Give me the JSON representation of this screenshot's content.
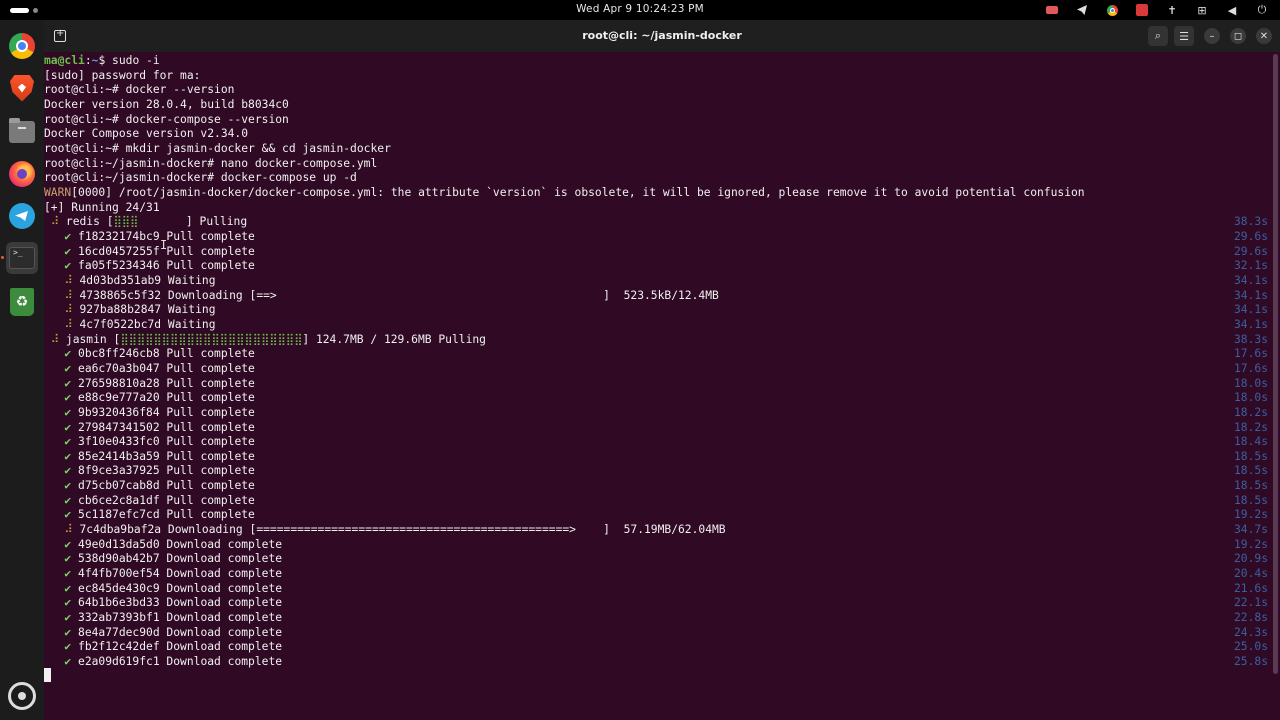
{
  "topbar": {
    "clock": "Wed Apr 9  10:24:23 PM",
    "power_icon": "⏻"
  },
  "window": {
    "title": "root@cli: ~/jasmin-docker"
  },
  "terminal": {
    "lines": [
      {
        "parts": [
          [
            "prompt-user",
            "ma@cli"
          ],
          [
            "",
            "",
            ""
          ],
          [
            "",
            ":"
          ],
          [
            "prompt-path",
            "~"
          ],
          [
            "",
            "$ sudo -i"
          ]
        ]
      },
      {
        "parts": [
          [
            "",
            "[sudo] password for ma:"
          ]
        ]
      },
      {
        "parts": [
          [
            "",
            "root@cli:~# docker --version"
          ]
        ]
      },
      {
        "parts": [
          [
            "",
            "Docker version 28.0.4, build b8034c0"
          ]
        ]
      },
      {
        "parts": [
          [
            "",
            "root@cli:~# docker-compose --version"
          ]
        ]
      },
      {
        "parts": [
          [
            "",
            "Docker Compose version v2.34.0"
          ]
        ]
      },
      {
        "parts": [
          [
            "",
            "root@cli:~# mkdir jasmin-docker && cd jasmin-docker"
          ]
        ]
      },
      {
        "parts": [
          [
            "",
            "root@cli:~/jasmin-docker# nano docker-compose.yml"
          ]
        ]
      },
      {
        "parts": [
          [
            "",
            "root@cli:~/jasmin-docker# docker-compose up -d"
          ]
        ]
      },
      {
        "parts": [
          [
            "warn",
            "WARN"
          ],
          [
            "",
            "[0000] /root/jasmin-docker/docker-compose.yml: the attribute `version` is obsolete, it will be ignored, please remove it to avoid potential confusion"
          ]
        ]
      },
      {
        "parts": [
          [
            "",
            "[+] Running 24/31"
          ]
        ]
      },
      {
        "parts": [
          [
            "spin",
            " ⠼ "
          ],
          [
            "",
            "redis ["
          ],
          [
            "bar",
            "⣿⣿⣿"
          ],
          [
            "",
            "       ] Pulling"
          ]
        ],
        "time": "38.3s"
      },
      {
        "parts": [
          [
            "check",
            "   ✔ "
          ],
          [
            "",
            "f18232174bc9 Pull complete"
          ]
        ],
        "time": "29.6s"
      },
      {
        "parts": [
          [
            "check",
            "   ✔ "
          ],
          [
            "",
            "16cd0457255f Pull complete"
          ]
        ],
        "time": "29.6s"
      },
      {
        "parts": [
          [
            "check",
            "   ✔ "
          ],
          [
            "",
            "fa05f5234346 Pull complete"
          ]
        ],
        "time": "32.1s"
      },
      {
        "parts": [
          [
            "spin",
            "   ⠼ "
          ],
          [
            "",
            "4d03bd351ab9 Waiting"
          ]
        ],
        "time": "34.1s"
      },
      {
        "parts": [
          [
            "spin",
            "   ⠼ "
          ],
          [
            "",
            "4738865c5f32 Downloading [==>                                                ]  523.5kB/12.4MB"
          ]
        ],
        "time": "34.1s"
      },
      {
        "parts": [
          [
            "spin",
            "   ⠼ "
          ],
          [
            "",
            "927ba88b2847 Waiting"
          ]
        ],
        "time": "34.1s"
      },
      {
        "parts": [
          [
            "spin",
            "   ⠼ "
          ],
          [
            "",
            "4c7f0522bc7d Waiting"
          ]
        ],
        "time": "34.1s"
      },
      {
        "parts": [
          [
            "spin",
            " ⠼ "
          ],
          [
            "",
            "jasmin ["
          ],
          [
            "bar",
            "⣿⣿⣿⣿⣿⣿⣿⣿⣿⣿⣿⣿⣿⣿⣿⣿⣿⣿⣿⣿⣿⣿"
          ],
          [
            "",
            "] 124.7MB / 129.6MB Pulling"
          ]
        ],
        "time": "38.3s"
      },
      {
        "parts": [
          [
            "check",
            "   ✔ "
          ],
          [
            "",
            "0bc8ff246cb8 Pull complete"
          ]
        ],
        "time": "17.6s"
      },
      {
        "parts": [
          [
            "check",
            "   ✔ "
          ],
          [
            "",
            "ea6c70a3b047 Pull complete"
          ]
        ],
        "time": "17.6s"
      },
      {
        "parts": [
          [
            "check",
            "   ✔ "
          ],
          [
            "",
            "276598810a28 Pull complete"
          ]
        ],
        "time": "18.0s"
      },
      {
        "parts": [
          [
            "check",
            "   ✔ "
          ],
          [
            "",
            "e88c9e777a20 Pull complete"
          ]
        ],
        "time": "18.0s"
      },
      {
        "parts": [
          [
            "check",
            "   ✔ "
          ],
          [
            "",
            "9b9320436f84 Pull complete"
          ]
        ],
        "time": "18.2s"
      },
      {
        "parts": [
          [
            "check",
            "   ✔ "
          ],
          [
            "",
            "279847341502 Pull complete"
          ]
        ],
        "time": "18.2s"
      },
      {
        "parts": [
          [
            "check",
            "   ✔ "
          ],
          [
            "",
            "3f10e0433fc0 Pull complete"
          ]
        ],
        "time": "18.4s"
      },
      {
        "parts": [
          [
            "check",
            "   ✔ "
          ],
          [
            "",
            "85e2414b3a59 Pull complete"
          ]
        ],
        "time": "18.5s"
      },
      {
        "parts": [
          [
            "check",
            "   ✔ "
          ],
          [
            "",
            "8f9ce3a37925 Pull complete"
          ]
        ],
        "time": "18.5s"
      },
      {
        "parts": [
          [
            "check",
            "   ✔ "
          ],
          [
            "",
            "d75cb07cab8d Pull complete"
          ]
        ],
        "time": "18.5s"
      },
      {
        "parts": [
          [
            "check",
            "   ✔ "
          ],
          [
            "",
            "cb6ce2c8a1df Pull complete"
          ]
        ],
        "time": "18.5s"
      },
      {
        "parts": [
          [
            "check",
            "   ✔ "
          ],
          [
            "",
            "5c1187efc7cd Pull complete"
          ]
        ],
        "time": "19.2s"
      },
      {
        "parts": [
          [
            "spin",
            "   ⠼ "
          ],
          [
            "",
            "7c4dba9baf2a Downloading [==============================================>    ]  57.19MB/62.04MB"
          ]
        ],
        "time": "34.7s"
      },
      {
        "parts": [
          [
            "check",
            "   ✔ "
          ],
          [
            "",
            "49e0d13da5d0 Download complete"
          ]
        ],
        "time": "19.2s"
      },
      {
        "parts": [
          [
            "check",
            "   ✔ "
          ],
          [
            "",
            "538d90ab42b7 Download complete"
          ]
        ],
        "time": "20.9s"
      },
      {
        "parts": [
          [
            "check",
            "   ✔ "
          ],
          [
            "",
            "4f4fb700ef54 Download complete"
          ]
        ],
        "time": "20.4s"
      },
      {
        "parts": [
          [
            "check",
            "   ✔ "
          ],
          [
            "",
            "ec845de430c9 Download complete"
          ]
        ],
        "time": "21.6s"
      },
      {
        "parts": [
          [
            "check",
            "   ✔ "
          ],
          [
            "",
            "64b1b6e3bd33 Download complete"
          ]
        ],
        "time": "22.1s"
      },
      {
        "parts": [
          [
            "check",
            "   ✔ "
          ],
          [
            "",
            "332ab7393bf1 Download complete"
          ]
        ],
        "time": "22.8s"
      },
      {
        "parts": [
          [
            "check",
            "   ✔ "
          ],
          [
            "",
            "8e4a77dec90d Download complete"
          ]
        ],
        "time": "24.3s"
      },
      {
        "parts": [
          [
            "check",
            "   ✔ "
          ],
          [
            "",
            "fb2f12c42def Download complete"
          ]
        ],
        "time": "25.0s"
      },
      {
        "parts": [
          [
            "check",
            "   ✔ "
          ],
          [
            "",
            "e2a09d619fc1 Download complete"
          ]
        ],
        "time": "25.8s"
      }
    ]
  },
  "colors": {
    "terminal_bg": "#300a24",
    "headerbar_bg": "#1f1f1f",
    "dock_bg": "#1c1c1c",
    "check": "#7ed36a",
    "prompt_user": "#6bbf4a"
  }
}
